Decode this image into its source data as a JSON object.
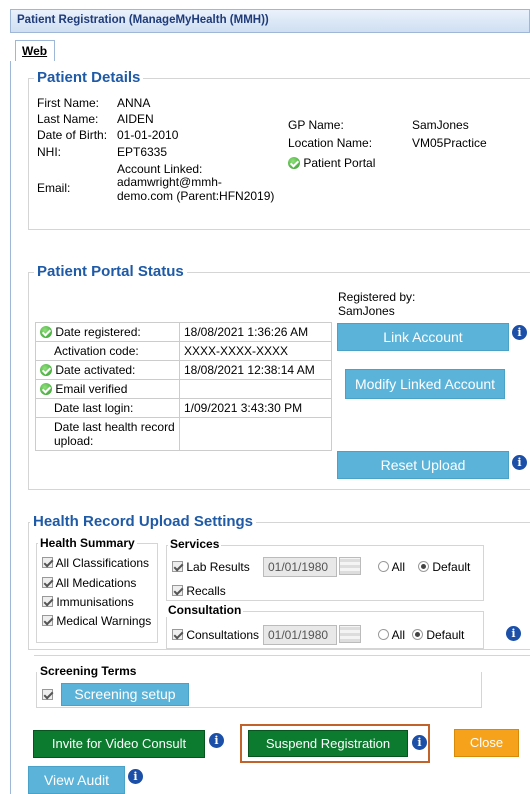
{
  "window": {
    "title": "Patient Registration (ManageMyHealth (MMH))",
    "tab": "Web"
  },
  "patient_details": {
    "heading": "Patient Details",
    "first_name_label": "First Name:",
    "first_name": "ANNA",
    "last_name_label": "Last Name:",
    "last_name": "AIDEN",
    "dob_label": "Date of Birth:",
    "dob": "01-01-2010",
    "nhi_label": "NHI:",
    "nhi": "EPT6335",
    "email_label": "Email:",
    "account_linked_label": "Account Linked:",
    "email_line1": "adamwright@mmh-",
    "email_line2": "demo.com (Parent:HFN2019)",
    "gp_label": "GP Name:",
    "gp": "SamJones",
    "location_label": "Location Name:",
    "location": "VM05Practice",
    "portal_label": "Patient Portal"
  },
  "portal_status": {
    "heading": "Patient Portal Status",
    "registered_by_label": "Registered by:",
    "registered_by": "SamJones",
    "rows": [
      {
        "label": "Date registered:",
        "value": "18/08/2021 1:36:26 AM",
        "ok": true
      },
      {
        "label": "Activation code:",
        "value": "XXXX-XXXX-XXXX",
        "ok": false
      },
      {
        "label": "Date activated:",
        "value": "18/08/2021 12:38:14 AM",
        "ok": true
      },
      {
        "label": "Email verified",
        "value": "",
        "ok": true
      },
      {
        "label": "Date last login:",
        "value": "1/09/2021 3:43:30 PM",
        "ok": false
      },
      {
        "label": "Date last health record upload:",
        "value": "",
        "ok": false
      }
    ],
    "link_account": "Link Account",
    "modify_linked": "Modify Linked Account",
    "reset_upload": "Reset Upload"
  },
  "upload_settings": {
    "heading": "Health Record Upload Settings",
    "health_summary_heading": "Health Summary",
    "health_summary_items": [
      "All Classifications",
      "All Medications",
      "Immunisations",
      "Medical Warnings"
    ],
    "services_heading": "Services",
    "lab_results": "Lab Results",
    "lab_date": "01/01/1980",
    "recalls": "Recalls",
    "all_label": "All",
    "default_label": "Default",
    "consultation_heading": "Consultation",
    "consultations": "Consultations",
    "consult_date": "01/01/1980",
    "screening_heading": "Screening Terms",
    "screening_setup": "Screening setup"
  },
  "footer": {
    "invite_video": "Invite for Video Consult",
    "suspend": "Suspend Registration",
    "close": "Close",
    "view_audit": "View Audit"
  },
  "colors": {
    "accent_blue": "#5bb3d9",
    "green": "#0c7a2f",
    "orange": "#f6a21b",
    "highlight_border": "#c0622a"
  }
}
